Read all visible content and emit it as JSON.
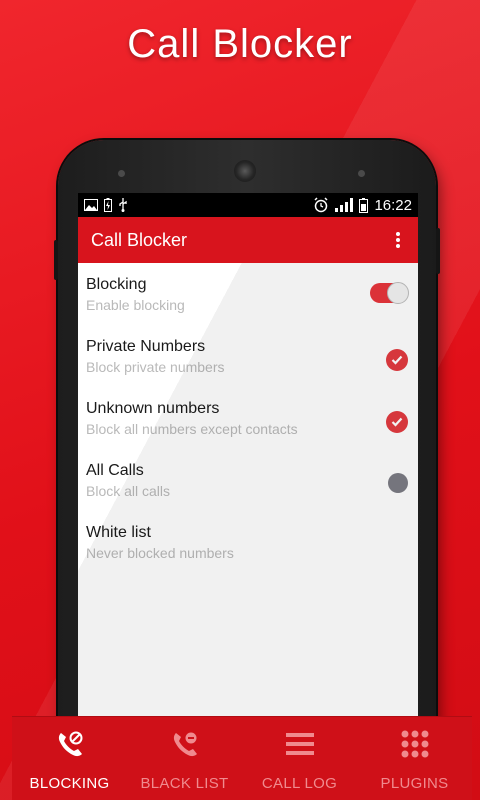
{
  "promo": {
    "title": "Call Blocker"
  },
  "statusbar": {
    "time": "16:22"
  },
  "appbar": {
    "title": "Call Blocker"
  },
  "settings": [
    {
      "title": "Blocking",
      "subtitle": "Enable blocking",
      "control": "toggle",
      "checked": true
    },
    {
      "title": "Private Numbers",
      "subtitle": "Block private numbers",
      "control": "check",
      "checked": true
    },
    {
      "title": "Unknown numbers",
      "subtitle": "Block all numbers except contacts",
      "control": "check",
      "checked": true
    },
    {
      "title": "All Calls",
      "subtitle": "Block all calls",
      "control": "check",
      "checked": false
    },
    {
      "title": "White list",
      "subtitle": "Never blocked numbers",
      "control": "none",
      "checked": false
    }
  ],
  "bottom_nav": [
    {
      "label": "BLOCKING",
      "icon": "phone-block-icon",
      "active": true
    },
    {
      "label": "BLACK LIST",
      "icon": "phone-minus-icon",
      "active": false
    },
    {
      "label": "CALL LOG",
      "icon": "list-icon",
      "active": false
    },
    {
      "label": "PLUGINS",
      "icon": "grid-icon",
      "active": false
    }
  ],
  "colors": {
    "primary": "#d8141d",
    "accent": "#e23a3f",
    "background": "#e8141f",
    "inactive_nav": "#f08a8e"
  }
}
